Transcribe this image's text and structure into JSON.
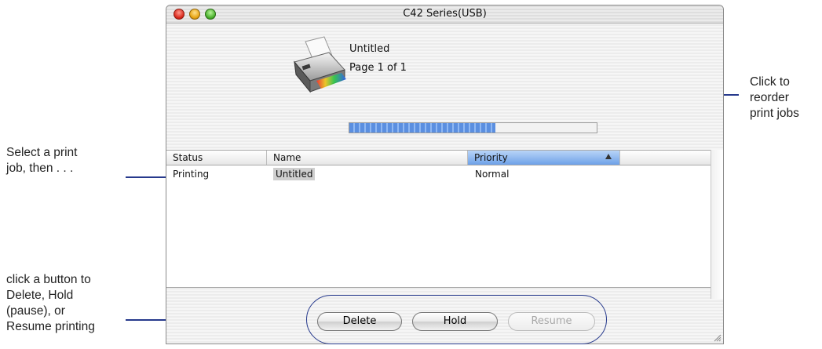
{
  "window": {
    "title": "C42 Series(USB)"
  },
  "job": {
    "document": "Untitled",
    "page_info": "Page 1 of 1",
    "progress": 0.59
  },
  "table": {
    "columns": [
      "Status",
      "Name",
      "Priority"
    ],
    "rows": [
      {
        "status": "Printing",
        "name": "Untitled",
        "priority": "Normal"
      }
    ]
  },
  "buttons": {
    "delete": "Delete",
    "hold": "Hold",
    "resume": "Resume"
  },
  "callouts": {
    "left_top": [
      "Select a print",
      "job, then . . ."
    ],
    "left_bottom": [
      "click a button to",
      "Delete, Hold",
      "(pause), or",
      "Resume printing"
    ],
    "right": [
      "Click to",
      "reorder",
      "print jobs"
    ]
  },
  "colors": {
    "callout_line": "#26398c",
    "progress_fill": "#5b8fe0",
    "selected_header": "#6ea1e8"
  },
  "icons": {
    "printer": "printer-icon",
    "sort": "sort-ascending-icon",
    "resize": "resize-grip-icon"
  }
}
